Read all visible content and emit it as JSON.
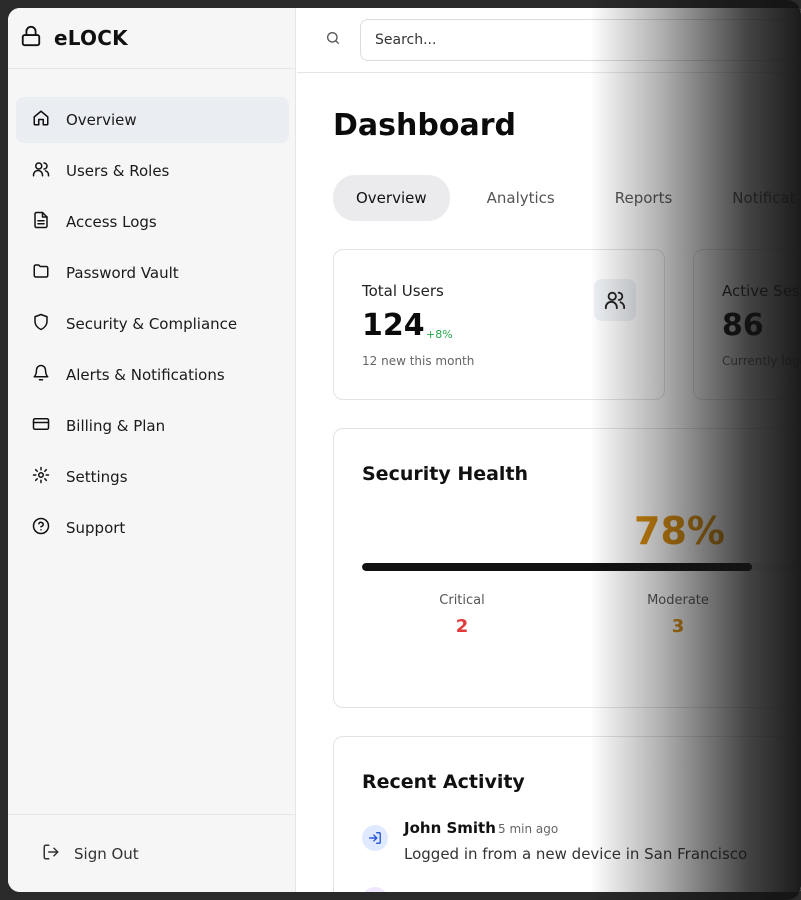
{
  "app": {
    "name": "eLOCK"
  },
  "sidebar": {
    "items": [
      {
        "label": "Overview",
        "icon": "home-icon",
        "active": true
      },
      {
        "label": "Users & Roles",
        "icon": "users-icon"
      },
      {
        "label": "Access Logs",
        "icon": "file-text-icon"
      },
      {
        "label": "Password Vault",
        "icon": "folder-icon"
      },
      {
        "label": "Security & Compliance",
        "icon": "shield-icon"
      },
      {
        "label": "Alerts & Notifications",
        "icon": "bell-icon"
      },
      {
        "label": "Billing & Plan",
        "icon": "credit-card-icon"
      },
      {
        "label": "Settings",
        "icon": "gear-icon"
      },
      {
        "label": "Support",
        "icon": "help-circle-icon"
      }
    ],
    "sign_out": "Sign Out"
  },
  "header": {
    "search_placeholder": "Search..."
  },
  "main": {
    "title": "Dashboard",
    "tabs": [
      {
        "label": "Overview",
        "active": true
      },
      {
        "label": "Analytics"
      },
      {
        "label": "Reports"
      },
      {
        "label": "Notificat"
      }
    ],
    "stats": [
      {
        "label": "Total Users",
        "value": "124",
        "delta": "+8%",
        "sub": "12 new this month",
        "icon": "users-icon"
      },
      {
        "label": "Active Sess",
        "value": "86",
        "sub": "Currently logg"
      }
    ],
    "security_health": {
      "title": "Security Health",
      "percent_label": "78%",
      "percent": 78,
      "metrics": [
        {
          "label": "Critical",
          "value": "2"
        },
        {
          "label": "Moderate",
          "value": "3"
        }
      ]
    },
    "recent_activity": {
      "title": "Recent Activity",
      "items": [
        {
          "user": "John Smith",
          "time": "5 min ago",
          "description": "Logged in from a new device in San Francisco",
          "icon": "login-icon"
        }
      ]
    }
  },
  "colors": {
    "accent_orange": "#d98c0a",
    "positive_green": "#22a84a",
    "critical_red": "#e23a3a"
  }
}
